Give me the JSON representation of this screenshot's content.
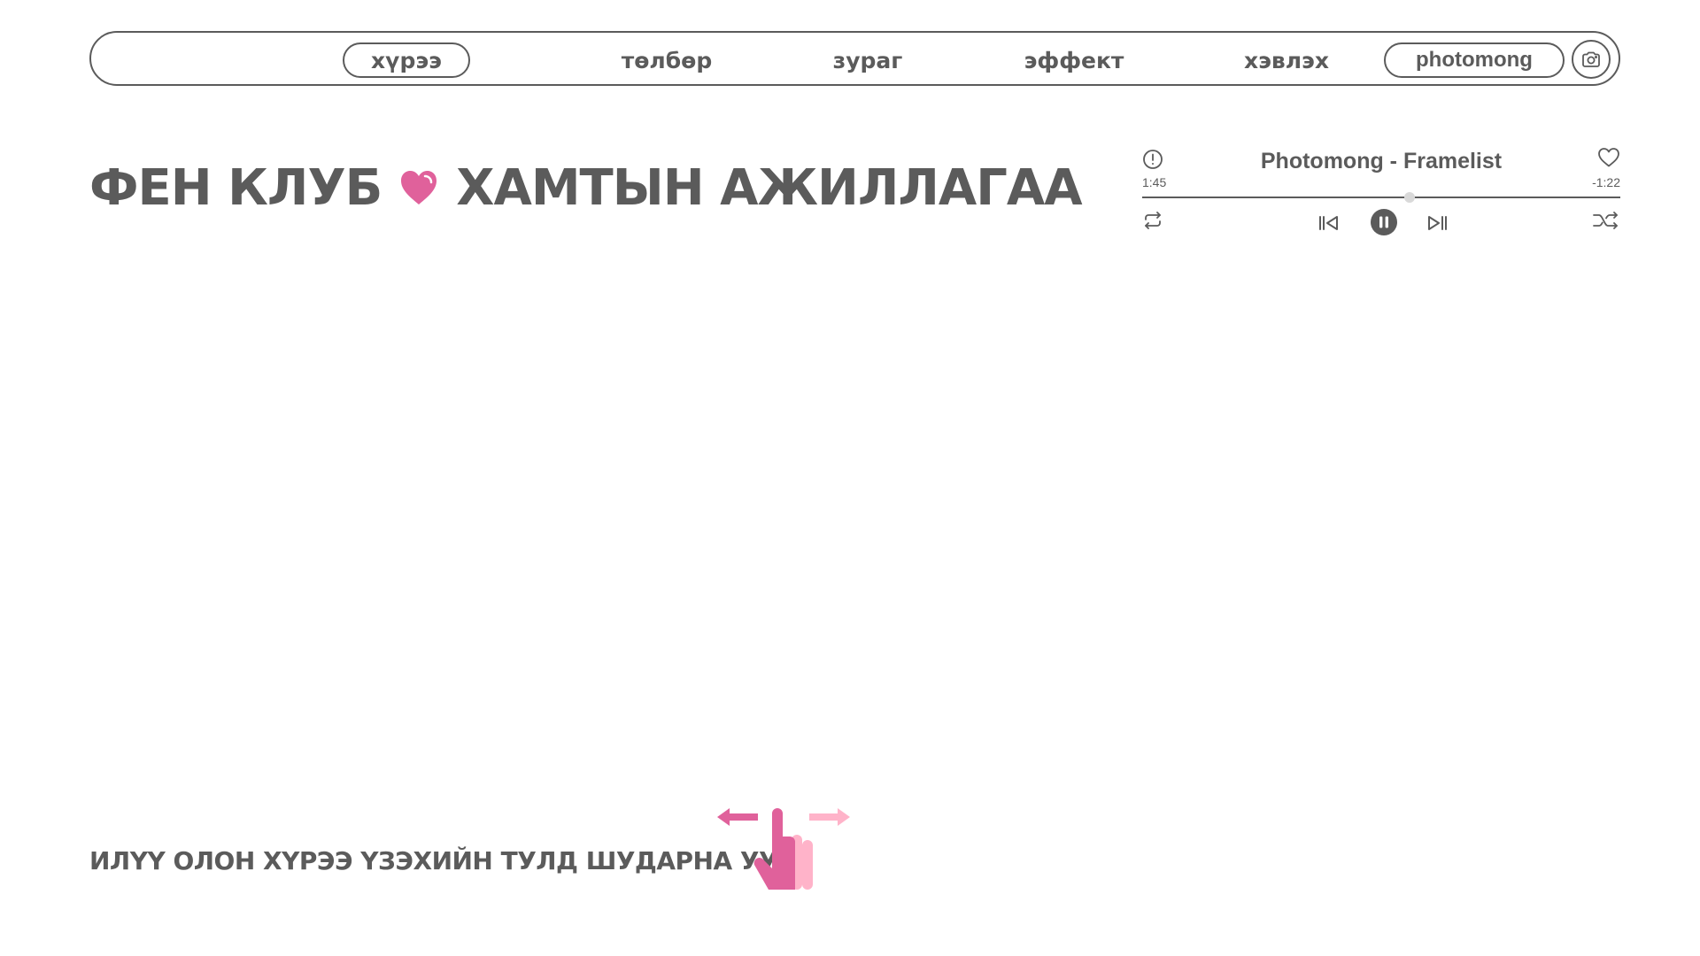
{
  "nav": {
    "items": [
      {
        "label": "хүрээ",
        "active": true
      },
      {
        "label": "төлбөр",
        "active": false
      },
      {
        "label": "зураг",
        "active": false
      },
      {
        "label": "эффект",
        "active": false
      },
      {
        "label": "хэвлэх",
        "active": false
      }
    ],
    "brand": "photomong",
    "camera_icon": "camera-icon"
  },
  "hero": {
    "title_left": "ФЕН КЛУБ",
    "title_right": "ХАМТЫН АЖИЛЛАГАА",
    "heart_icon": "heart-icon"
  },
  "player": {
    "track_title": "Photomong - Framelist",
    "time_elapsed": "1:45",
    "time_remaining": "-1:22",
    "progress_fraction": 0.56,
    "state": "playing",
    "icons": [
      "info-icon",
      "like-icon",
      "repeat-icon",
      "previous-icon",
      "pause-icon",
      "next-icon",
      "shuffle-icon"
    ]
  },
  "swipe_hint": {
    "text": "ИЛҮҮ ОЛОН ХҮРЭЭ ҮЗЭХИЙН ТУЛД ШУДАРНА УУ",
    "icon": "swipe-gesture-icon"
  },
  "colors": {
    "text": "#5b5b5b",
    "pink": "#e0619b",
    "light_pink": "#ffb3c9",
    "background": "#ffffff"
  }
}
